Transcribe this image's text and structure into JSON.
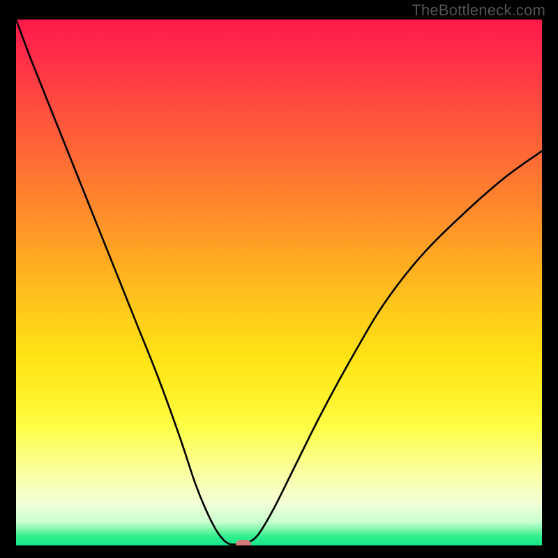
{
  "watermark": "TheBottleneck.com",
  "chart_data": {
    "type": "line",
    "title": "",
    "xlabel": "",
    "ylabel": "",
    "xlim": [
      0,
      100
    ],
    "ylim": [
      0,
      100
    ],
    "grid": false,
    "legend": false,
    "series": [
      {
        "name": "curve",
        "x": [
          0,
          3,
          7,
          11,
          15,
          19,
          23,
          27,
          31,
          34,
          36,
          38,
          39.5,
          40.5,
          41,
          42,
          43,
          44,
          46,
          49,
          53,
          58,
          64,
          70,
          77,
          85,
          93,
          100
        ],
        "y": [
          100,
          92,
          82,
          72,
          62,
          52,
          42,
          32,
          21,
          12,
          7,
          3,
          1,
          0.3,
          0.2,
          0.2,
          0.2,
          0.5,
          2,
          7,
          15,
          25,
          36,
          46,
          55,
          63,
          70,
          75
        ]
      }
    ],
    "marker": {
      "x": 43.2,
      "y": 0.1
    },
    "background_gradient": {
      "top": "#ff1a4b",
      "mid": "#ffe315",
      "bottom": "#17e58a"
    },
    "annotations": []
  }
}
